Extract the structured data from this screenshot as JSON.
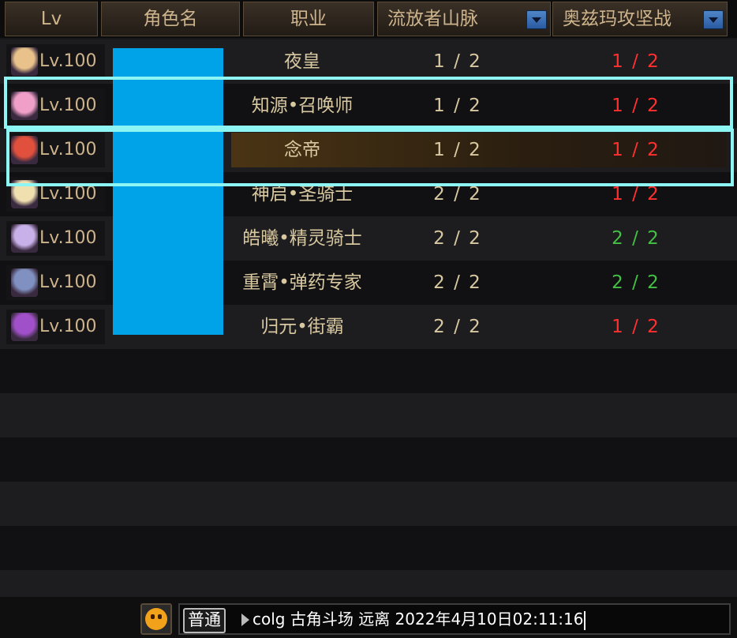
{
  "header": {
    "lv": "Lv",
    "name": "角色名",
    "job": "职业",
    "col1": "流放者山脉",
    "col2": "奥兹玛攻坚战"
  },
  "rows": [
    {
      "lv": "Lv.100",
      "job": "夜皇",
      "c1": "1 / 2",
      "c2": "1 / 2",
      "c2color": "red",
      "avatar": "#e8c28a"
    },
    {
      "lv": "Lv.100",
      "job": "知源•召唤师",
      "c1": "1 / 2",
      "c2": "1 / 2",
      "c2color": "red",
      "avatar": "#f0a0c8"
    },
    {
      "lv": "Lv.100",
      "job": "念帝",
      "c1": "1 / 2",
      "c2": "1 / 2",
      "c2color": "red",
      "avatar": "#e0503c"
    },
    {
      "lv": "Lv.100",
      "job": "神启•圣骑士",
      "c1": "2 / 2",
      "c2": "1 / 2",
      "c2color": "red",
      "avatar": "#f0e0b0"
    },
    {
      "lv": "Lv.100",
      "job": "皓曦•精灵骑士",
      "c1": "2 / 2",
      "c2": "2 / 2",
      "c2color": "green",
      "avatar": "#c8b0e8"
    },
    {
      "lv": "Lv.100",
      "job": "重霄•弹药专家",
      "c1": "2 / 2",
      "c2": "2 / 2",
      "c2color": "green",
      "avatar": "#8090c0"
    },
    {
      "lv": "Lv.100",
      "job": "归元•街霸",
      "c1": "2 / 2",
      "c2": "1 / 2",
      "c2color": "red",
      "avatar": "#a050c8"
    }
  ],
  "colors": {
    "red": "#ff3030",
    "green": "#44c044",
    "mask": "#00a2e8",
    "highlight": "#8ef5f5"
  },
  "chat": {
    "channel": "普通",
    "text": "colg 古角斗场 远离 2022年4月10日02:11:16"
  }
}
